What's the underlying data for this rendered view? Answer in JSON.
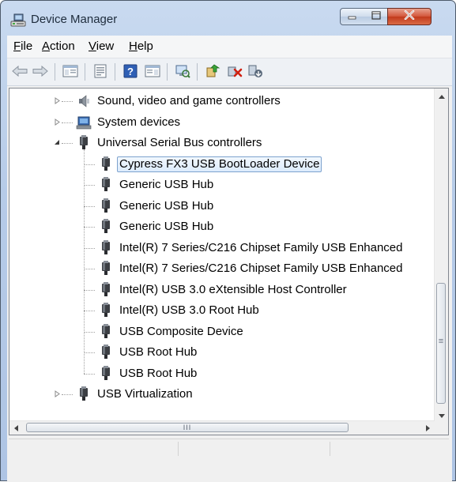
{
  "window": {
    "title": "Device Manager",
    "buttons": {
      "minimize": "minimize",
      "maximize": "maximize",
      "close": "close"
    }
  },
  "menu": [
    {
      "label": "File",
      "accel": "F",
      "rest": "ile"
    },
    {
      "label": "Action",
      "accel": "A",
      "rest": "ction"
    },
    {
      "label": "View",
      "accel": "V",
      "rest": "iew"
    },
    {
      "label": "Help",
      "accel": "H",
      "rest": "elp"
    }
  ],
  "toolbar": {
    "icons": [
      "back-icon",
      "forward-icon",
      "show-hide-console-tree-icon",
      "properties-icon",
      "help-icon",
      "action-pane-icon",
      "scan-hardware-icon",
      "update-driver-icon",
      "uninstall-icon",
      "disable-device-icon"
    ]
  },
  "tree": {
    "rows": [
      {
        "label": "Sound, video and game controllers",
        "level": 1,
        "expander": "collapsed",
        "icon": "speaker-icon"
      },
      {
        "label": "System devices",
        "level": 1,
        "expander": "collapsed",
        "icon": "computer-icon"
      },
      {
        "label": "Universal Serial Bus controllers",
        "level": 1,
        "expander": "expanded",
        "icon": "usb-plug-icon"
      },
      {
        "label": "Cypress FX3 USB BootLoader Device",
        "level": 2,
        "selected": true,
        "icon": "usb-plug-icon"
      },
      {
        "label": "Generic USB Hub",
        "level": 2,
        "icon": "usb-plug-icon"
      },
      {
        "label": "Generic USB Hub",
        "level": 2,
        "icon": "usb-plug-icon"
      },
      {
        "label": "Generic USB Hub",
        "level": 2,
        "icon": "usb-plug-icon"
      },
      {
        "label": "Intel(R) 7 Series/C216 Chipset Family USB Enhanced",
        "level": 2,
        "icon": "usb-plug-icon"
      },
      {
        "label": "Intel(R) 7 Series/C216 Chipset Family USB Enhanced",
        "level": 2,
        "icon": "usb-plug-icon"
      },
      {
        "label": "Intel(R) USB 3.0 eXtensible Host Controller",
        "level": 2,
        "icon": "usb-plug-icon"
      },
      {
        "label": "Intel(R) USB 3.0 Root Hub",
        "level": 2,
        "icon": "usb-plug-icon"
      },
      {
        "label": "USB Composite Device",
        "level": 2,
        "icon": "usb-plug-icon"
      },
      {
        "label": "USB Root Hub",
        "level": 2,
        "icon": "usb-plug-icon"
      },
      {
        "label": "USB Root Hub",
        "level": 2,
        "icon": "usb-plug-icon"
      },
      {
        "label": "USB Virtualization",
        "level": 1,
        "expander": "collapsed",
        "icon": "usb-plug-icon"
      }
    ]
  },
  "scrollbars": {
    "horizontal_grip": "III",
    "vertical_grip": "≡"
  },
  "colors": {
    "selection_border": "#7da2ce",
    "close_button": "#c23a1c",
    "title_bar": "#b6cbe8"
  }
}
